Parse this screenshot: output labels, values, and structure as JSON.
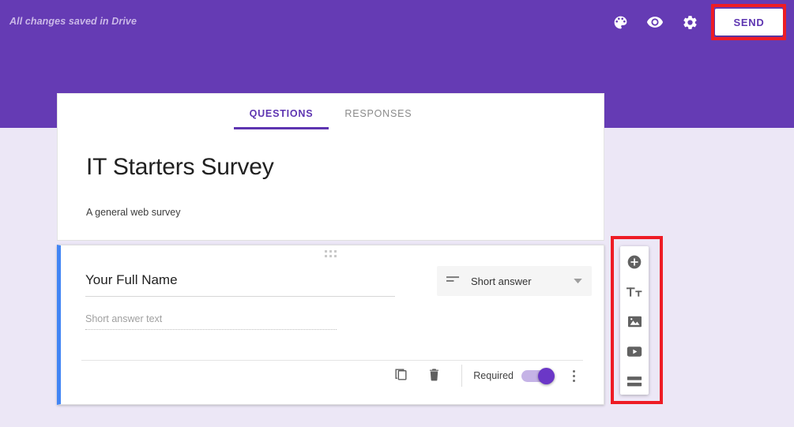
{
  "header": {
    "save_status": "All changes saved in Drive",
    "background_color": "#653BB4",
    "icons": [
      {
        "name": "palette-icon",
        "label": "Change theme"
      },
      {
        "name": "eye-icon",
        "label": "Preview"
      },
      {
        "name": "gear-icon",
        "label": "Settings"
      }
    ],
    "send_label": "SEND"
  },
  "tabs": [
    {
      "label": "QUESTIONS",
      "active": true
    },
    {
      "label": "RESPONSES",
      "active": false
    }
  ],
  "form": {
    "title": "IT Starters Survey",
    "description": "A general web survey"
  },
  "question": {
    "title": "Your Full Name",
    "answer_placeholder": "Short answer text",
    "type_label": "Short answer",
    "required_label": "Required",
    "required_on": true,
    "accent_color": "#4285F4",
    "footer_icons": [
      {
        "name": "duplicate-icon",
        "label": "Duplicate"
      },
      {
        "name": "delete-icon",
        "label": "Delete"
      }
    ]
  },
  "side_toolbar": {
    "items": [
      {
        "name": "add-question-icon",
        "label": "Add question"
      },
      {
        "name": "add-title-icon",
        "label": "Add title and description"
      },
      {
        "name": "add-image-icon",
        "label": "Add image"
      },
      {
        "name": "add-video-icon",
        "label": "Add video"
      },
      {
        "name": "add-section-icon",
        "label": "Add section"
      }
    ]
  },
  "annotations": {
    "color": "#EE1C25",
    "boxes": [
      {
        "name": "send-button-highlight"
      },
      {
        "name": "side-toolbar-highlight"
      }
    ]
  }
}
